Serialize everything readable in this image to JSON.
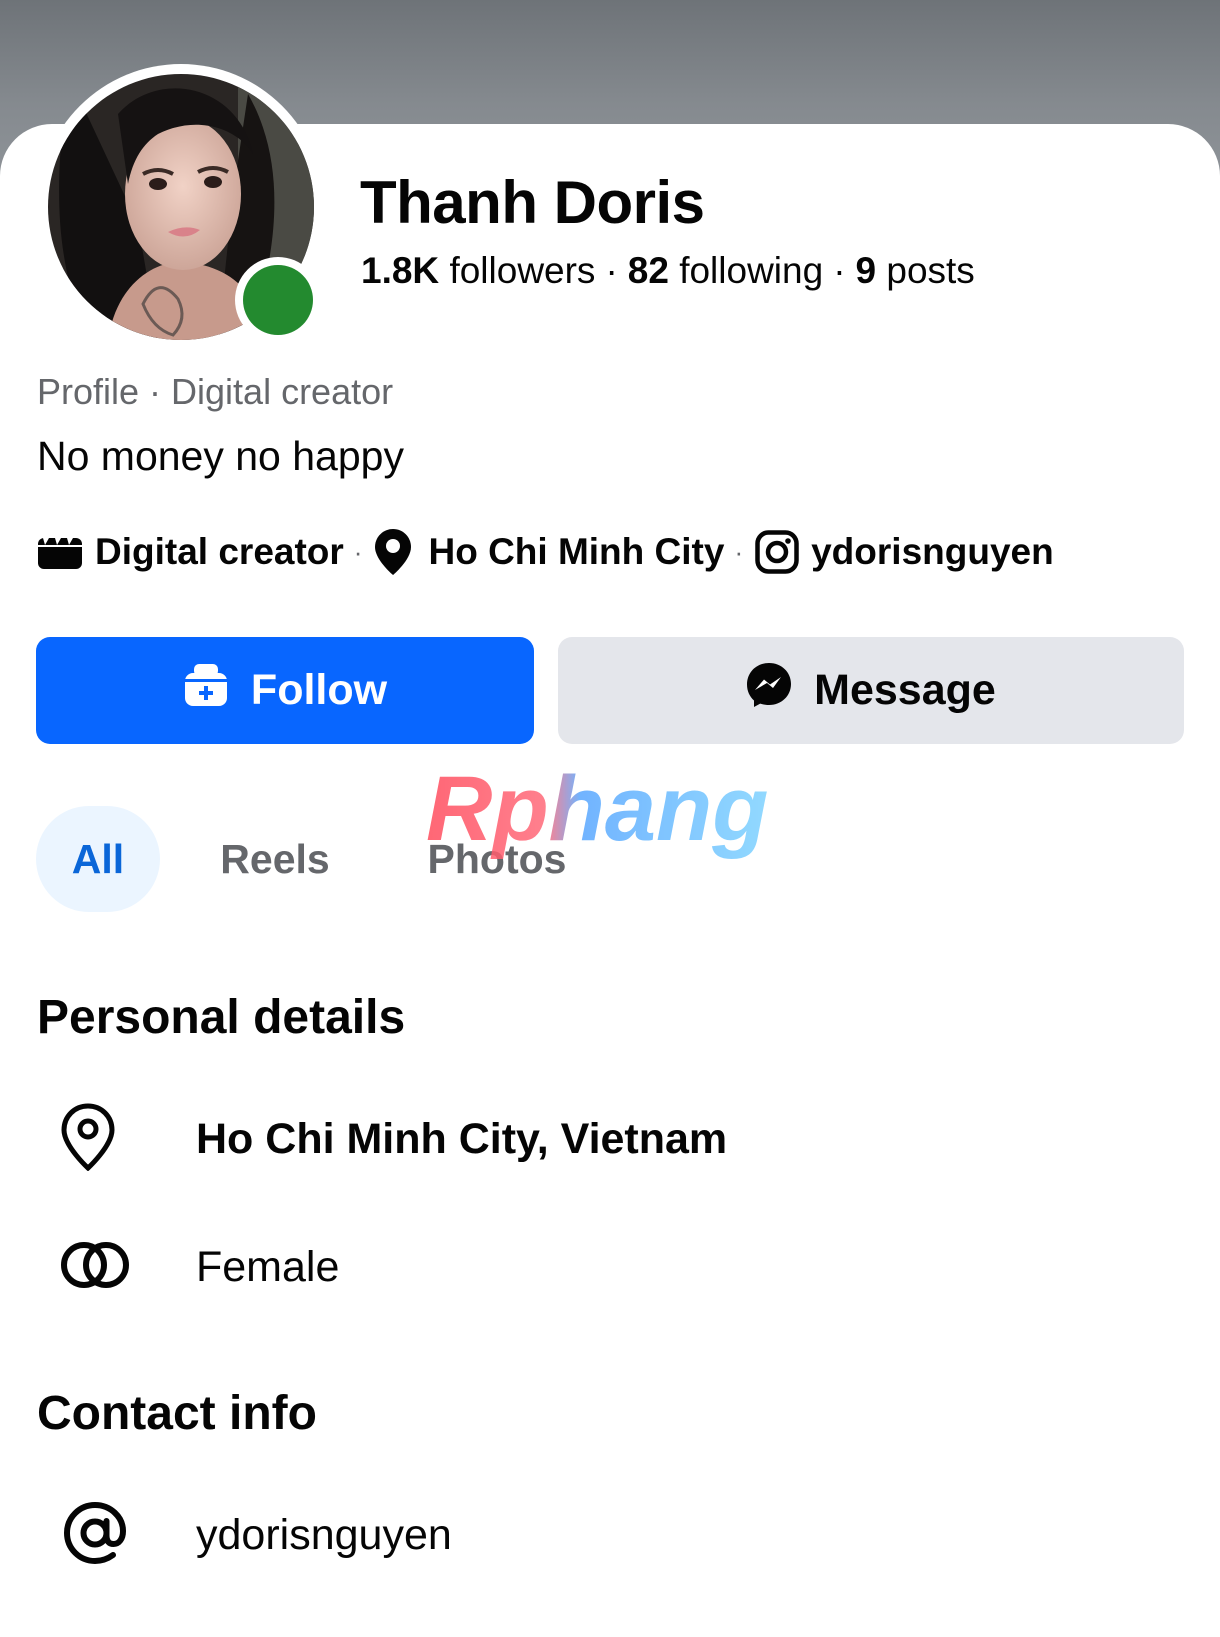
{
  "profile": {
    "name": "Thanh Doris",
    "followers_count": "1.8K",
    "followers_label": "followers",
    "following_count": "82",
    "following_label": "following",
    "posts_count": "9",
    "posts_label": "posts",
    "separator": "·",
    "subtitle": "Profile · Digital creator",
    "bio": "No money no happy",
    "online": true,
    "online_color": "#238a2f"
  },
  "meta": {
    "category": "Digital creator",
    "location": "Ho Chi Minh City",
    "instagram": "ydorisnguyen",
    "separator": "·",
    "icons": [
      "clapperboard-icon",
      "map-pin-icon",
      "instagram-icon"
    ]
  },
  "actions": {
    "follow_label": "Follow",
    "message_label": "Message",
    "follow_color": "#0866ff",
    "message_color": "#e4e6eb"
  },
  "tabs": [
    {
      "label": "All",
      "active": true
    },
    {
      "label": "Reels",
      "active": false
    },
    {
      "label": "Photos",
      "active": false
    }
  ],
  "watermark": {
    "text": "Rphang"
  },
  "personal_details": {
    "title": "Personal details",
    "items": [
      {
        "icon": "location-pin-icon",
        "value": "Ho Chi Minh City, Vietnam"
      },
      {
        "icon": "gender-rings-icon",
        "value": "Female"
      }
    ]
  },
  "contact_info": {
    "title": "Contact info",
    "items": [
      {
        "icon": "at-sign-icon",
        "value": "ydorisnguyen"
      }
    ]
  },
  "colors": {
    "primary": "#0866ff",
    "secondary_text": "#65676b",
    "tab_active_bg": "#ebf5ff",
    "tab_active_text": "#0a66d8"
  }
}
